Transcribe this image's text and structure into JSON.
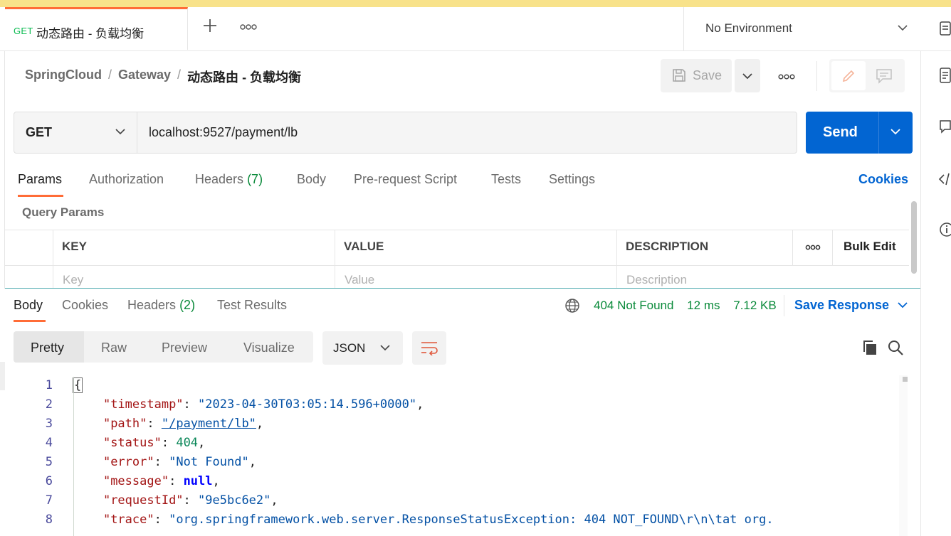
{
  "tab": {
    "method": "GET",
    "title": "动态路由 - 负载均衡"
  },
  "environment": {
    "selected": "No Environment"
  },
  "breadcrumb": {
    "collection": "SpringCloud",
    "folder": "Gateway",
    "request": "动态路由 - 负载均衡",
    "separator": "/"
  },
  "toolbar": {
    "save_label": "Save"
  },
  "request": {
    "method": "GET",
    "url": "localhost:9527/payment/lb",
    "send_label": "Send"
  },
  "request_tabs": [
    {
      "label": "Params"
    },
    {
      "label": "Authorization"
    },
    {
      "label": "Headers",
      "count": "(7)"
    },
    {
      "label": "Body"
    },
    {
      "label": "Pre-request Script"
    },
    {
      "label": "Tests"
    },
    {
      "label": "Settings"
    }
  ],
  "cookies_label": "Cookies",
  "query_params": {
    "title": "Query Params",
    "columns": [
      "KEY",
      "VALUE",
      "DESCRIPTION"
    ],
    "bulk_edit": "Bulk Edit",
    "placeholders": {
      "key": "Key",
      "value": "Value",
      "description": "Description"
    }
  },
  "response_tabs": [
    {
      "label": "Body"
    },
    {
      "label": "Cookies"
    },
    {
      "label": "Headers",
      "count": "(2)"
    },
    {
      "label": "Test Results"
    }
  ],
  "response_status": {
    "status": "404 Not Found",
    "time": "12 ms",
    "size": "7.12 KB",
    "save_label": "Save Response"
  },
  "format_tabs": [
    "Pretty",
    "Raw",
    "Preview",
    "Visualize"
  ],
  "language": "JSON",
  "code_lines": [
    {
      "n": "1",
      "text": "{"
    },
    {
      "n": "2",
      "key": "\"timestamp\"",
      "value": "\"2023-04-30T03:05:14.596+0000\"",
      "type": "str"
    },
    {
      "n": "3",
      "key": "\"path\"",
      "value": "\"/payment/lb\"",
      "type": "url"
    },
    {
      "n": "4",
      "key": "\"status\"",
      "value": "404",
      "type": "num"
    },
    {
      "n": "5",
      "key": "\"error\"",
      "value": "\"Not Found\"",
      "type": "str"
    },
    {
      "n": "6",
      "key": "\"message\"",
      "value": "null",
      "type": "kw"
    },
    {
      "n": "7",
      "key": "\"requestId\"",
      "value": "\"9e5bc6e2\"",
      "type": "str"
    },
    {
      "n": "8",
      "key": "\"trace\"",
      "value": "\"org.springframework.web.server.ResponseStatusException: 404 NOT_FOUND\\r\\n\\tat org.",
      "type": "str"
    }
  ]
}
